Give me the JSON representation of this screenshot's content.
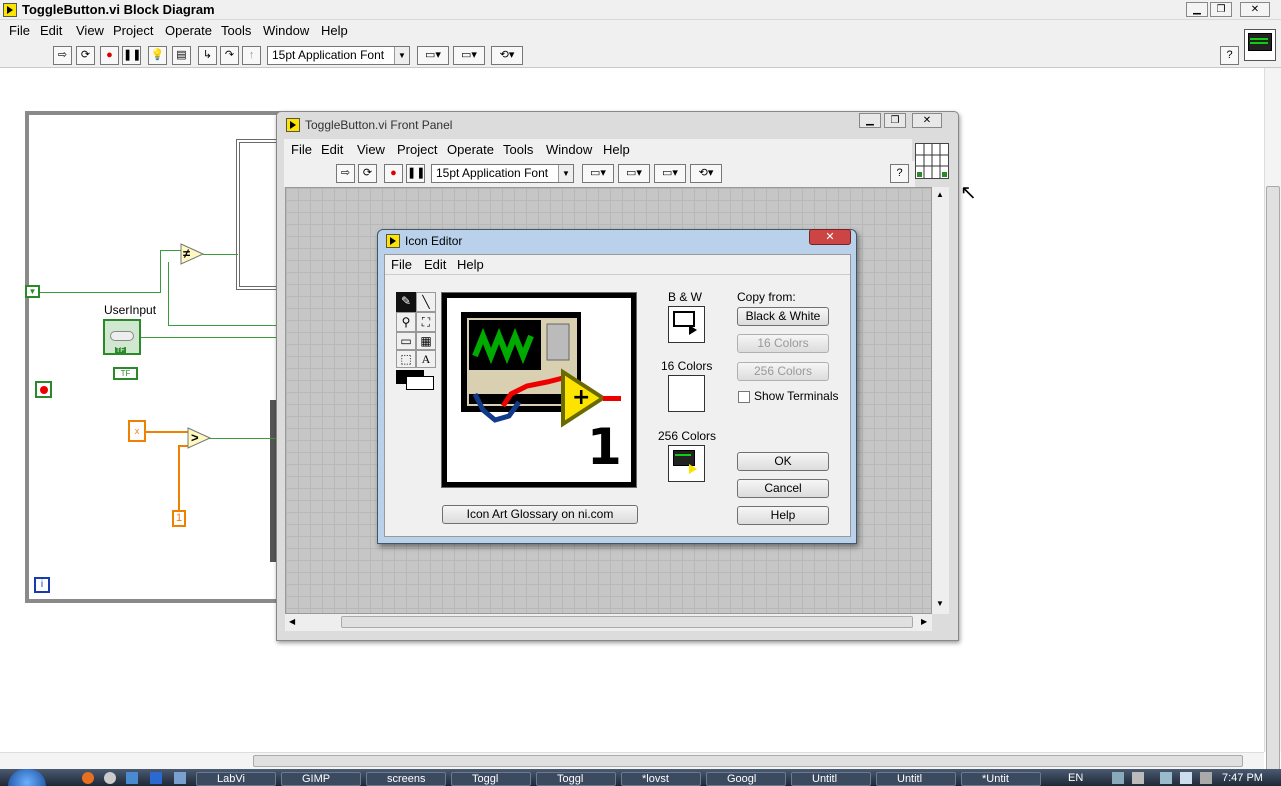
{
  "main_window": {
    "title": "ToggleButton.vi Block Diagram",
    "menu": [
      "File",
      "Edit",
      "View",
      "Project",
      "Operate",
      "Tools",
      "Window",
      "Help"
    ],
    "font_select": "15pt Application Font"
  },
  "diagram": {
    "userinput_label": "UserInput",
    "tf_label": "TF",
    "tf2_label": "TF",
    "not_equal_symbol": "≠",
    "greater_symbol": ">",
    "x_label": "x",
    "const_one": "1",
    "iteration_label": "i"
  },
  "front_panel": {
    "title": "ToggleButton.vi Front Panel",
    "menu": [
      "File",
      "Edit",
      "View",
      "Project",
      "Operate",
      "Tools",
      "Window",
      "Help"
    ],
    "font_select": "15pt Application Font"
  },
  "icon_editor": {
    "title": "Icon Editor",
    "menu": [
      "File",
      "Edit",
      "Help"
    ],
    "bw_label": "B & W",
    "colors16_label": "16 Colors",
    "colors256_label": "256 Colors",
    "copy_from_label": "Copy from:",
    "copy_bw_button": "Black & White",
    "copy_16_button": "16 Colors",
    "copy_256_button": "256 Colors",
    "show_terminals_label": "Show Terminals",
    "show_terminals_checked": false,
    "ok_button": "OK",
    "cancel_button": "Cancel",
    "help_button": "Help",
    "glossary_button": "Icon Art Glossary on ni.com",
    "icon_digit": "1"
  },
  "taskbar": {
    "items": [
      "LabVi",
      "GIMP",
      "screens",
      "Toggl",
      "Toggl",
      "*lovst",
      "Googl",
      "Untitl",
      "Untitl",
      "*Untit"
    ],
    "lang": "EN",
    "clock": "7:47 PM"
  },
  "colors": {
    "accent_yellow": "#fde400",
    "wire_green": "#3a9b3a",
    "wire_orange": "#f08000",
    "dialog_frame": "#b9d1ea"
  }
}
